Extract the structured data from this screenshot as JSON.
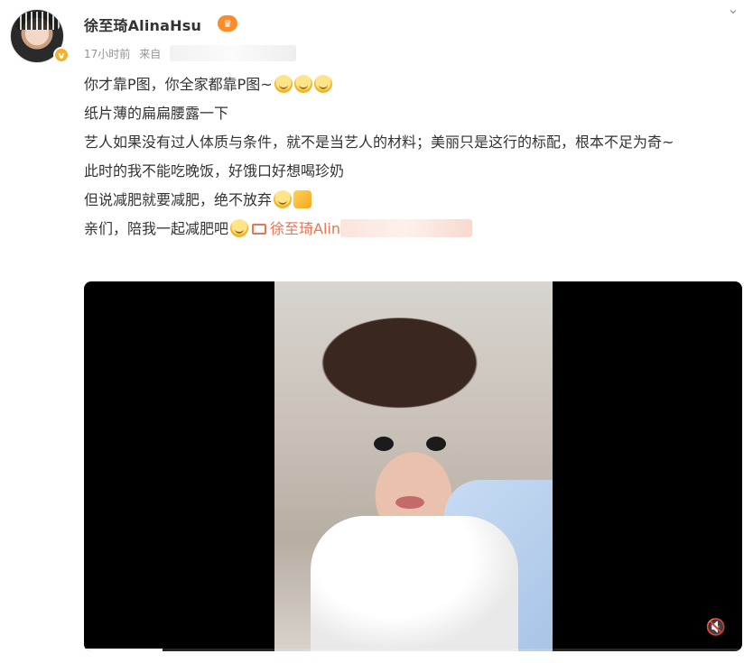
{
  "post": {
    "username": "徐至琦AlinaHsu",
    "vip_badge": "♛",
    "time": "17小时前",
    "source_label": "来自",
    "lines": [
      "你才靠P图，你全家都靠P图~",
      "纸片薄的扁扁腰露一下",
      "艺人如果没有过人体质与条件，就不是当艺人的材料；美丽只是这行的标配，根本不足为奇~",
      "此时的我不能吃晚饭，好饿口好想喝珍奶",
      "但说减肥就要减肥，绝不放弃",
      "亲们，陪我一起减肥吧"
    ],
    "video_link_text": "徐至琦Alin"
  },
  "video": {
    "progress": 0.12
  },
  "icons": {
    "verified": "verified-icon",
    "chevron": "chevron-down-icon",
    "mute": "mute-icon",
    "emoji": "emoji-icon"
  },
  "colors": {
    "link": "#eb7350",
    "meta": "#939393",
    "verified": "#f6b12c"
  }
}
